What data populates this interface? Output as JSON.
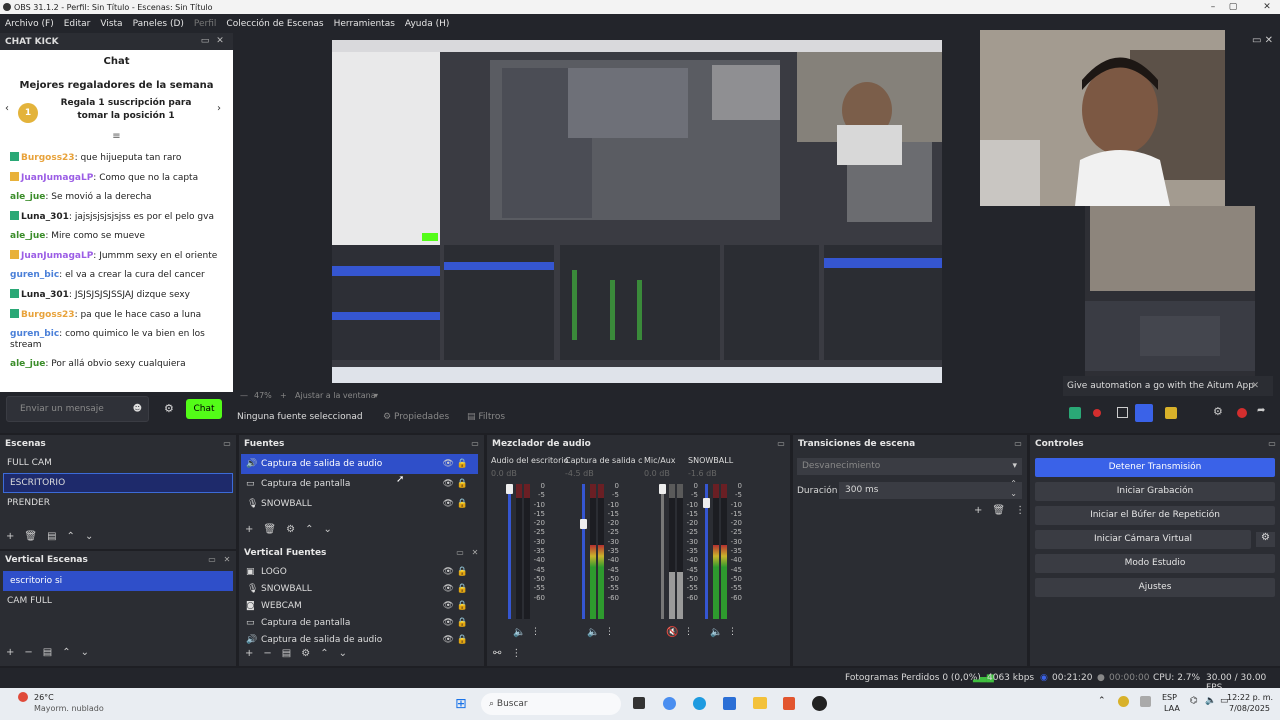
{
  "window": {
    "title": "OBS 31.1.2 - Perfil: Sin Título - Escenas: Sin Título"
  },
  "menu": [
    {
      "label": "Archivo (F)",
      "dim": false
    },
    {
      "label": "Editar",
      "dim": false
    },
    {
      "label": "Vista",
      "dim": false
    },
    {
      "label": "Paneles (D)",
      "dim": false
    },
    {
      "label": "Perfil",
      "dim": true
    },
    {
      "label": "Colección de Escenas",
      "dim": false
    },
    {
      "label": "Herramientas",
      "dim": false
    },
    {
      "label": "Ayuda (H)",
      "dim": false
    }
  ],
  "chat": {
    "dock_title": "CHAT KICK",
    "title": "Chat",
    "leaderboard": "Mejores regaladores de la semana",
    "gift_text": "Regala 1 suscripción para tomar la posición 1",
    "gift_badge": "1",
    "messages": [
      {
        "user": "Burgoss23",
        "color": "#e8a23a",
        "text": ": que hijueputa tan raro",
        "badge": "#2aa876"
      },
      {
        "user": "JuanJumagaLP",
        "color": "#9b5de5",
        "text": ": Como que no la capta",
        "badge": "#e8b13a"
      },
      {
        "user": "ale_jue",
        "color": "#3b8d2a",
        "text": ": Se movió a la derecha",
        "badge": ""
      },
      {
        "user": "Luna_301",
        "color": "#222222",
        "text": ": jajsjsjsjsjsjss es por el pelo gva",
        "badge": "#2aa876"
      },
      {
        "user": "ale_jue",
        "color": "#3b8d2a",
        "text": ": Mire como se mueve",
        "badge": ""
      },
      {
        "user": "JuanJumagaLP",
        "color": "#9b5de5",
        "text": ": Jummm sexy en el oriente",
        "badge": "#e8b13a"
      },
      {
        "user": "guren_bic",
        "color": "#4a7fd8",
        "text": ": el va a crear la cura del cancer",
        "badge": ""
      },
      {
        "user": "Luna_301",
        "color": "#222222",
        "text": ": JSJSJSJSJSSJAJ dizque sexy",
        "badge": "#2aa876"
      },
      {
        "user": "Burgoss23",
        "color": "#e8a23a",
        "text": ": pa que le hace caso a luna",
        "badge": "#2aa876"
      },
      {
        "user": "guren_bic",
        "color": "#4a7fd8",
        "text": ": como quimico le va bien en los stream",
        "badge": ""
      },
      {
        "user": "ale_jue",
        "color": "#3b8d2a",
        "text": ": Por allá obvio sexy cualquiera",
        "badge": ""
      }
    ],
    "input_placeholder": "Enviar un mensaje",
    "send_label": "Chat"
  },
  "preview": {
    "notification": "Give automation a go with the Aitum App",
    "zoom_text": "47%",
    "fit_text": "Ajustar a la ventana"
  },
  "source_bar": {
    "none_selected": "Ninguna fuente seleccionad",
    "properties": "Propiedades",
    "filters": "Filtros"
  },
  "scenes": {
    "title": "Escenas",
    "items": [
      "FULL CAM",
      "ESCRITORIO",
      "PRENDER"
    ],
    "selected": 1
  },
  "vertical_scenes": {
    "title": "Vertical Escenas",
    "items": [
      "escritorio si",
      "CAM FULL"
    ],
    "selected": 0
  },
  "sources": {
    "title": "Fuentes",
    "items": [
      {
        "label": "Captura de salida de audio",
        "icon": "speaker-icon"
      },
      {
        "label": "Captura de pantalla",
        "icon": "monitor-icon"
      },
      {
        "label": "SNOWBALL",
        "icon": "microphone-icon"
      }
    ],
    "selected": 0
  },
  "vertical_sources": {
    "title": "Vertical Fuentes",
    "items": [
      {
        "label": "LOGO",
        "icon": "image-icon"
      },
      {
        "label": "SNOWBALL",
        "icon": "microphone-icon"
      },
      {
        "label": "WEBCAM",
        "icon": "camera-icon"
      },
      {
        "label": "Captura de pantalla",
        "icon": "monitor-icon"
      },
      {
        "label": "Captura de salida de audio",
        "icon": "speaker-icon"
      }
    ]
  },
  "mixer": {
    "title": "Mezclador de audio",
    "channels": [
      {
        "name": "Audio del escritorio",
        "db": "0.0 dB",
        "level": 0.0,
        "volume": 1.0,
        "muted": false
      },
      {
        "name": "Captura de salida c",
        "db": "-4.5 dB",
        "level": 0.55,
        "volume": 0.74,
        "muted": false
      },
      {
        "name": "Mic/Aux",
        "db": "0.0 dB",
        "level": 0.35,
        "volume": 1.0,
        "muted": true
      },
      {
        "name": "SNOWBALL",
        "db": "-1.6 dB",
        "level": 0.55,
        "volume": 0.9,
        "muted": false
      }
    ],
    "scale": [
      "0",
      "-5",
      "-10",
      "-15",
      "-20",
      "-25",
      "-30",
      "-35",
      "-40",
      "-45",
      "-50",
      "-55",
      "-60"
    ]
  },
  "transitions": {
    "title": "Transiciones de escena",
    "type": "Desvanecimiento",
    "duration_label": "Duración",
    "duration_value": "300 ms"
  },
  "controls": {
    "title": "Controles",
    "buttons": [
      "Detener Transmisión",
      "Iniciar Grabación",
      "Iniciar el Búfer de Repetición",
      "Iniciar Cámara Virtual",
      "Modo Estudio",
      "Ajustes"
    ]
  },
  "status": {
    "dropped": "Fotogramas Perdidos 0 (0,0%)",
    "bitrate": "4063 kbps",
    "live_time": "00:21:20",
    "rec_time": "00:00:00",
    "cpu": "CPU: 2.7%",
    "fps": "30.00 / 30.00 FPS"
  },
  "taskbar": {
    "temp": "26°C",
    "weather": "Mayorm. nublado",
    "search": "Buscar",
    "lang": "ESP",
    "lang2": "LAA",
    "time": "12:22 p. m.",
    "date": "7/08/2025"
  },
  "colors": {
    "accent": "#3a62e8",
    "kick_green": "#53fc18",
    "panel": "#2b2d33",
    "bg": "#1e1f24"
  }
}
